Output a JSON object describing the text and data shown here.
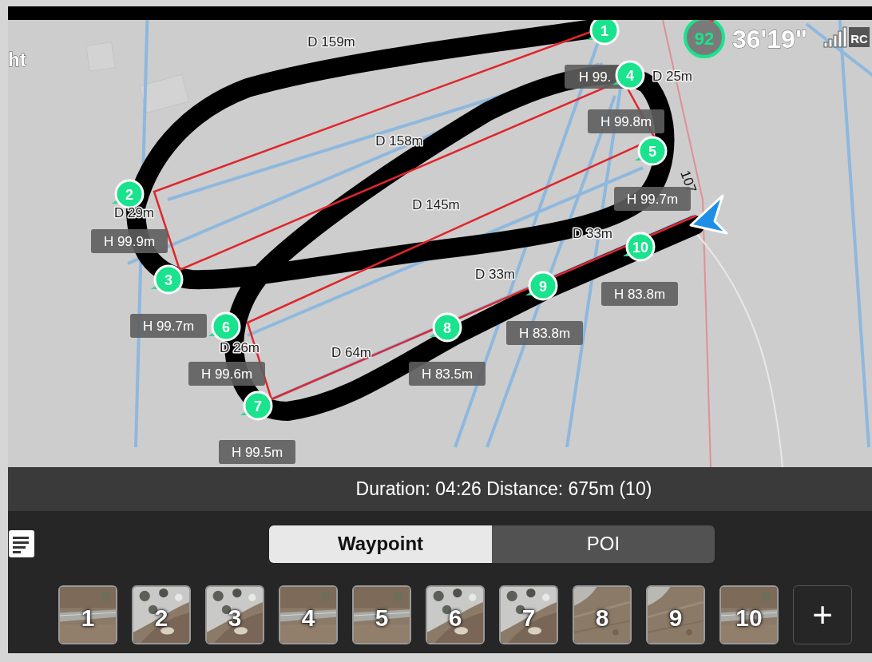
{
  "map": {
    "corner_text": "ht",
    "road_number": "107",
    "distance_labels": [
      {
        "text": "D 159m"
      },
      {
        "text": "D 158m"
      },
      {
        "text": "D 145m"
      },
      {
        "text": "D 29m"
      },
      {
        "text": "D 25m"
      },
      {
        "text": "D 33m"
      },
      {
        "text": "D 33m"
      },
      {
        "text": "D 26m"
      },
      {
        "text": "D 64m"
      }
    ],
    "height_labels": [
      {
        "text": "H 99."
      },
      {
        "text": "H 99.8m"
      },
      {
        "text": "H 99.9m"
      },
      {
        "text": "H 99.7m"
      },
      {
        "text": "H 99.7m"
      },
      {
        "text": "H 99.6m"
      },
      {
        "text": "H 99.5m"
      },
      {
        "text": "H 83.5m"
      },
      {
        "text": "H 83.8m"
      },
      {
        "text": "H 83.8m"
      }
    ],
    "waypoints": [
      {
        "number": "1"
      },
      {
        "number": "2"
      },
      {
        "number": "3"
      },
      {
        "number": "4"
      },
      {
        "number": "5"
      },
      {
        "number": "6"
      },
      {
        "number": "7"
      },
      {
        "number": "8"
      },
      {
        "number": "9"
      },
      {
        "number": "10"
      }
    ]
  },
  "status": {
    "battery": "92",
    "flight_time": "36'19\"",
    "signal_label": "RC"
  },
  "summary": "Duration: 04:26 Distance: 675m (10)",
  "tabs": [
    {
      "label": "Waypoint",
      "selected": true
    },
    {
      "label": "POI",
      "selected": false
    }
  ],
  "thumbnails": [
    {
      "number": "1"
    },
    {
      "number": "2"
    },
    {
      "number": "3"
    },
    {
      "number": "4"
    },
    {
      "number": "5"
    },
    {
      "number": "6"
    },
    {
      "number": "7"
    },
    {
      "number": "8"
    },
    {
      "number": "9"
    },
    {
      "number": "10"
    }
  ],
  "add_button": "+"
}
